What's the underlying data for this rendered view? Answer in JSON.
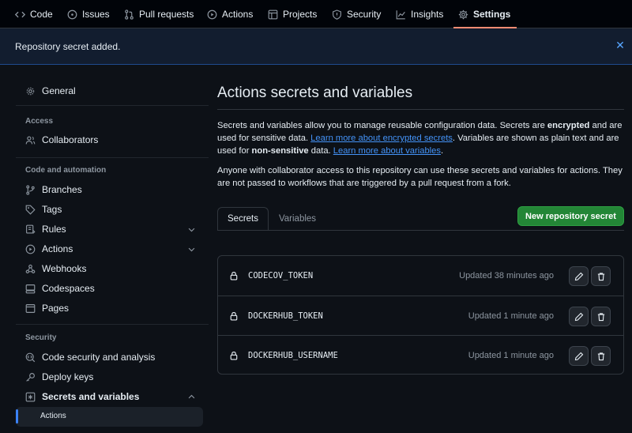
{
  "nav": {
    "items": [
      {
        "label": "Code",
        "icon": "code-icon"
      },
      {
        "label": "Issues",
        "icon": "issue-icon"
      },
      {
        "label": "Pull requests",
        "icon": "pull-request-icon"
      },
      {
        "label": "Actions",
        "icon": "play-icon"
      },
      {
        "label": "Projects",
        "icon": "table-icon"
      },
      {
        "label": "Security",
        "icon": "shield-icon"
      },
      {
        "label": "Insights",
        "icon": "graph-icon"
      },
      {
        "label": "Settings",
        "icon": "gear-icon",
        "active": true
      }
    ]
  },
  "flash": {
    "message": "Repository secret added.",
    "close": "✕"
  },
  "sidebar": {
    "general": "General",
    "access_heading": "Access",
    "collaborators": "Collaborators",
    "code_automation_heading": "Code and automation",
    "branches": "Branches",
    "tags": "Tags",
    "rules": "Rules",
    "actions": "Actions",
    "webhooks": "Webhooks",
    "codespaces": "Codespaces",
    "pages": "Pages",
    "security_heading": "Security",
    "code_security": "Code security and analysis",
    "deploy_keys": "Deploy keys",
    "secrets_variables": "Secrets and variables",
    "sub_actions": "Actions"
  },
  "main": {
    "title": "Actions secrets and variables",
    "intro": {
      "p1_a": "Secrets and variables allow you to manage reusable configuration data. Secrets are ",
      "p1_b": "encrypted",
      "p1_c": " and are used for sensitive data. ",
      "p1_link1": "Learn more about encrypted secrets",
      "p1_d": ". Variables are shown as plain text and are used for ",
      "p1_e": "non-sensitive",
      "p1_f": " data. ",
      "p1_link2": "Learn more about variables",
      "p1_g": ".",
      "p2": "Anyone with collaborator access to this repository can use these secrets and variables for actions. They are not passed to workflows that are triggered by a pull request from a fork."
    },
    "tabs": {
      "secrets": "Secrets",
      "variables": "Variables"
    },
    "new_secret_button": "New repository secret",
    "secrets": [
      {
        "name": "CODECOV_TOKEN",
        "updated": "Updated 38 minutes ago"
      },
      {
        "name": "DOCKERHUB_TOKEN",
        "updated": "Updated 1 minute ago"
      },
      {
        "name": "DOCKERHUB_USERNAME",
        "updated": "Updated 1 minute ago"
      }
    ]
  },
  "colors": {
    "accent": "#fd8c73",
    "link": "#4493f8",
    "primary_button": "#238636"
  }
}
